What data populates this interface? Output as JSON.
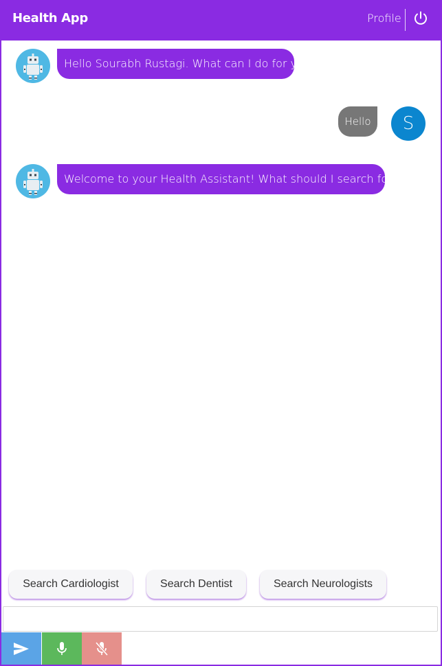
{
  "header": {
    "title": "Health App",
    "profile_label": "Profile",
    "power_icon": "power-icon"
  },
  "messages": [
    {
      "sender": "bot",
      "text": "Hello Sourabh Rustagi. What can I do for you?"
    },
    {
      "sender": "user",
      "text": "Hello",
      "avatar_initial": "S"
    },
    {
      "sender": "bot",
      "text": "Welcome to your Health Assistant! What should I search for you?"
    }
  ],
  "quick_replies": [
    "Search Cardiologist",
    "Search Dentist",
    "Search Neurologists"
  ],
  "input": {
    "value": "",
    "placeholder": ""
  },
  "actions": {
    "send_icon": "send-icon",
    "mic_icon": "microphone-icon",
    "mic_off_icon": "microphone-off-icon"
  },
  "colors": {
    "brand": "#8a2be2",
    "user_bubble": "#777777",
    "user_avatar": "#0b86cf",
    "bot_avatar": "#4fb8e4",
    "send": "#5ba4e6",
    "mic": "#5cb85c",
    "mic_off": "#e5908b"
  }
}
